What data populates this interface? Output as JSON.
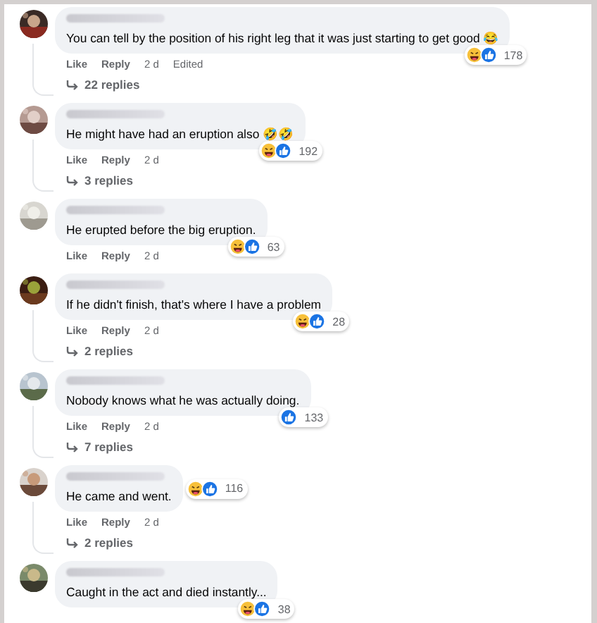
{
  "comments": [
    {
      "text": "You can tell by the position of his right leg that it was just starting to get good 😂",
      "reactions": {
        "icons": [
          {
            "kind": "haha"
          },
          {
            "kind": "like"
          }
        ],
        "count": "178"
      },
      "actions": {
        "like": "Like",
        "reply": "Reply",
        "time": "2 d",
        "edited": "Edited"
      },
      "replies": "22 replies"
    },
    {
      "text": "He might have had an eruption also 🤣🤣",
      "reactions": {
        "icons": [
          {
            "kind": "haha"
          },
          {
            "kind": "like"
          }
        ],
        "count": "192"
      },
      "actions": {
        "like": "Like",
        "reply": "Reply",
        "time": "2 d"
      },
      "replies": "3 replies"
    },
    {
      "text": "He erupted before the big eruption.",
      "reactions": {
        "icons": [
          {
            "kind": "haha"
          },
          {
            "kind": "like"
          }
        ],
        "count": "63"
      },
      "actions": {
        "like": "Like",
        "reply": "Reply",
        "time": "2 d"
      }
    },
    {
      "text": "If he didn't finish, that's where I have a problem",
      "reactions": {
        "icons": [
          {
            "kind": "haha"
          },
          {
            "kind": "like"
          }
        ],
        "count": "28"
      },
      "actions": {
        "like": "Like",
        "reply": "Reply",
        "time": "2 d"
      },
      "replies": "2 replies"
    },
    {
      "text": "Nobody knows what he was actually doing.",
      "reactions": {
        "icons": [
          {
            "kind": "like"
          }
        ],
        "count": "133"
      },
      "actions": {
        "like": "Like",
        "reply": "Reply",
        "time": "2 d"
      },
      "replies": "7 replies"
    },
    {
      "text": "He came and went.",
      "reactions": {
        "icons": [
          {
            "kind": "haha"
          },
          {
            "kind": "like"
          }
        ],
        "count": "116"
      },
      "actions": {
        "like": "Like",
        "reply": "Reply",
        "time": "2 d"
      },
      "replies": "2 replies"
    },
    {
      "text": "Caught in the act and died instantly...",
      "reactions": {
        "icons": [
          {
            "kind": "haha"
          },
          {
            "kind": "like"
          }
        ],
        "count": "38"
      }
    }
  ]
}
